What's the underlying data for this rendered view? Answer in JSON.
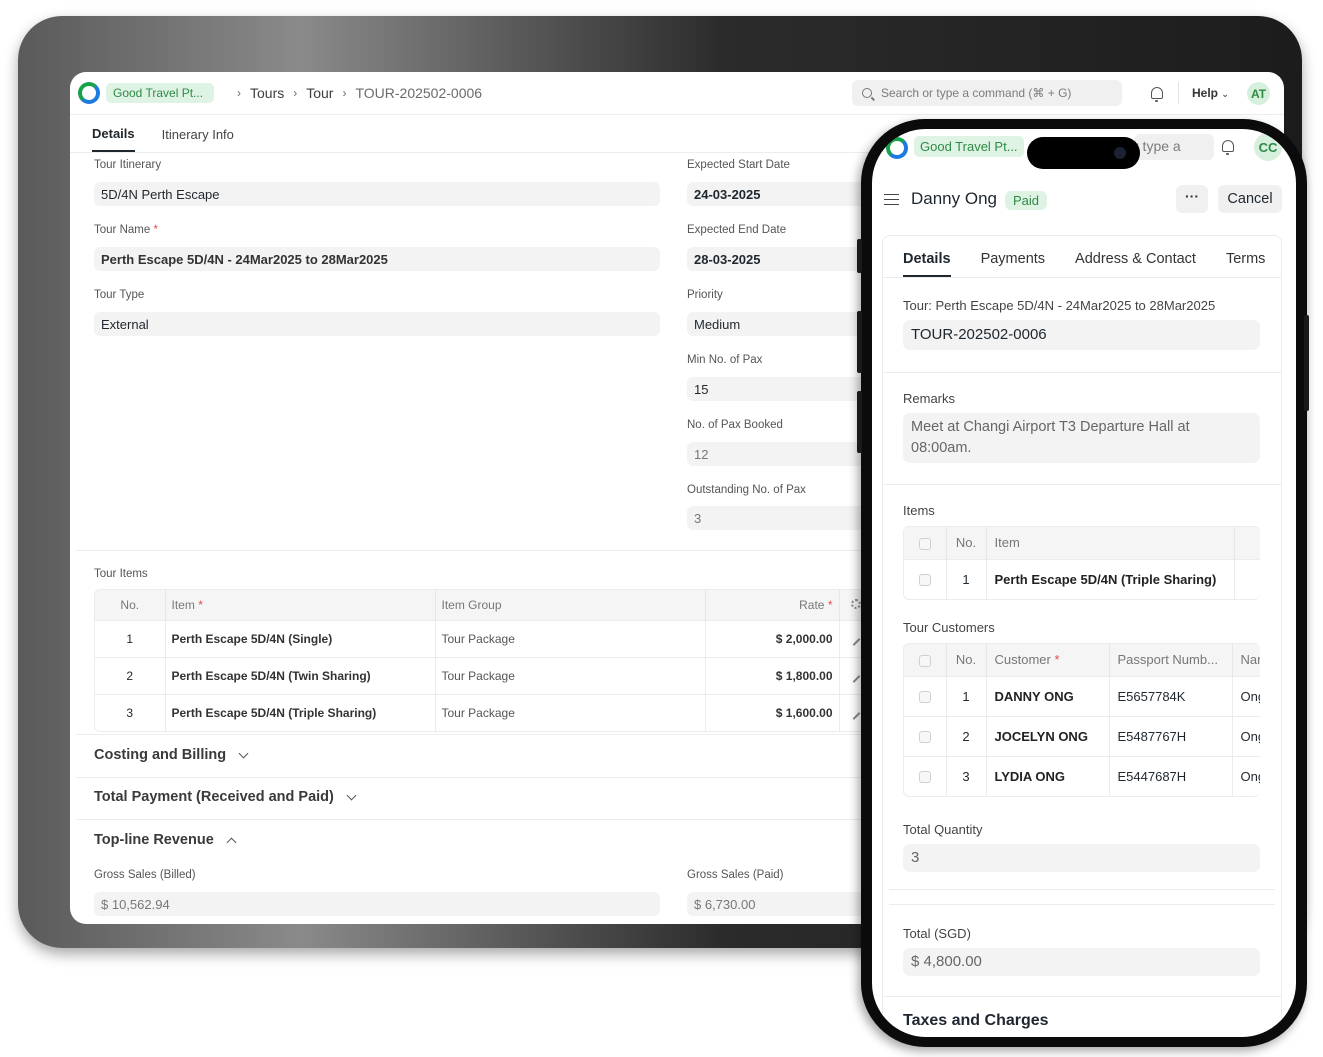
{
  "tablet": {
    "company": "Good Travel Pt...",
    "breadcrumbs": [
      "Tours",
      "Tour",
      "TOUR-202502-0006"
    ],
    "search_placeholder": "Search or type a command (⌘ + G)",
    "help_label": "Help",
    "avatar_initials": "AT",
    "tabs": [
      "Details",
      "Itinerary Info"
    ],
    "fields": {
      "tour_itinerary_label": "Tour Itinerary",
      "tour_itinerary_value": "5D/4N Perth Escape",
      "tour_name_label": "Tour Name",
      "tour_name_value": "Perth Escape 5D/4N - 24Mar2025 to 28Mar2025",
      "tour_type_label": "Tour Type",
      "tour_type_value": "External",
      "expected_start_label": "Expected Start Date",
      "expected_start_value": "24-03-2025",
      "expected_end_label": "Expected End Date",
      "expected_end_value": "28-03-2025",
      "priority_label": "Priority",
      "priority_value": "Medium",
      "min_pax_label": "Min No. of Pax",
      "min_pax_value": "15",
      "pax_booked_label": "No. of Pax Booked",
      "pax_booked_value": "12",
      "outstanding_pax_label": "Outstanding No. of Pax",
      "outstanding_pax_value": "3"
    },
    "tour_items": {
      "label": "Tour Items",
      "headers": {
        "no": "No.",
        "item": "Item",
        "item_group": "Item Group",
        "rate": "Rate"
      },
      "rows": [
        {
          "no": "1",
          "item": "Perth Escape 5D/4N (Single)",
          "group": "Tour Package",
          "rate": "$ 2,000.00"
        },
        {
          "no": "2",
          "item": "Perth Escape 5D/4N (Twin Sharing)",
          "group": "Tour Package",
          "rate": "$ 1,800.00"
        },
        {
          "no": "3",
          "item": "Perth Escape 5D/4N (Triple Sharing)",
          "group": "Tour Package",
          "rate": "$ 1,600.00"
        }
      ]
    },
    "sections": {
      "costing": "Costing and Billing",
      "total_payment": "Total Payment (Received and Paid)",
      "topline": "Top-line Revenue"
    },
    "revenue": {
      "gross_billed_label": "Gross Sales (Billed)",
      "gross_billed_value": "$ 10,562.94",
      "gross_paid_label": "Gross Sales (Paid)",
      "gross_paid_value": "$ 6,730.00"
    }
  },
  "phone": {
    "company": "Good Travel Pt...",
    "search_fragment": "r type a",
    "avatar_initials": "CC",
    "title": "Danny Ong",
    "status": "Paid",
    "more_label": "···",
    "cancel_label": "Cancel",
    "tabs": [
      "Details",
      "Payments",
      "Address & Contact",
      "Terms"
    ],
    "tour_label": "Tour: Perth Escape 5D/4N - 24Mar2025 to 28Mar2025",
    "tour_value": "TOUR-202502-0006",
    "remarks_label": "Remarks",
    "remarks_value": "Meet at Changi Airport T3 Departure Hall at 08:00am.",
    "items": {
      "label": "Items",
      "headers": {
        "no": "No.",
        "item": "Item"
      },
      "rows": [
        {
          "no": "1",
          "item": "Perth Escape 5D/4N (Triple Sharing)"
        }
      ]
    },
    "customers": {
      "label": "Tour Customers",
      "headers": {
        "no": "No.",
        "customer": "Customer",
        "passport": "Passport Numb...",
        "name": "Nar"
      },
      "rows": [
        {
          "no": "1",
          "customer": "DANNY ONG",
          "passport": "E5657784K",
          "name": "Ong"
        },
        {
          "no": "2",
          "customer": "JOCELYN ONG",
          "passport": "E5487767H",
          "name": "Ong"
        },
        {
          "no": "3",
          "customer": "LYDIA ONG",
          "passport": "E5447687H",
          "name": "Ong"
        }
      ]
    },
    "total_qty_label": "Total Quantity",
    "total_qty_value": "3",
    "total_label": "Total (SGD)",
    "total_value": "$ 4,800.00",
    "taxes_heading": "Taxes and Charges"
  }
}
